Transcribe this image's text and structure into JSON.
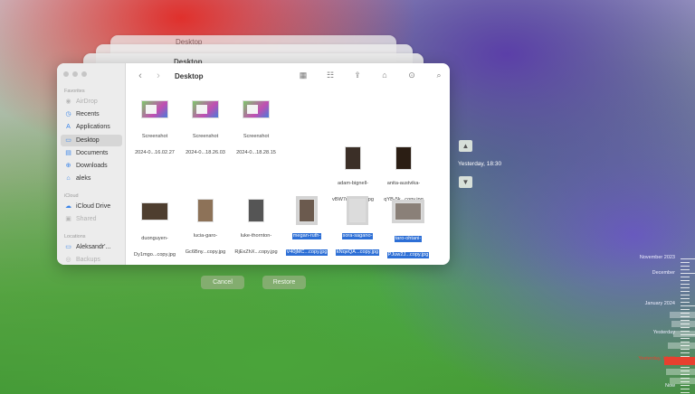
{
  "stack": {
    "back_title": "Desktop",
    "mid_title": "Desktop"
  },
  "window": {
    "title": "Desktop",
    "sidebar": {
      "favorites_header": "Favorites",
      "favorites": [
        {
          "label": "AirDrop",
          "icon": "airdrop-icon",
          "glyph": "◉",
          "dim": true
        },
        {
          "label": "Recents",
          "icon": "clock-icon",
          "glyph": "◷",
          "dim": false
        },
        {
          "label": "Applications",
          "icon": "applications-icon",
          "glyph": "A",
          "dim": false
        },
        {
          "label": "Desktop",
          "icon": "desktop-icon",
          "glyph": "▭",
          "dim": false,
          "active": true
        },
        {
          "label": "Documents",
          "icon": "document-icon",
          "glyph": "▤",
          "dim": false
        },
        {
          "label": "Downloads",
          "icon": "download-icon",
          "glyph": "⊕",
          "dim": false
        },
        {
          "label": "aleks",
          "icon": "home-icon",
          "glyph": "⌂",
          "dim": false
        }
      ],
      "icloud_header": "iCloud",
      "icloud": [
        {
          "label": "iCloud Drive",
          "icon": "cloud-icon",
          "glyph": "☁",
          "dim": false
        },
        {
          "label": "Shared",
          "icon": "shared-folder-icon",
          "glyph": "▣",
          "dim": true
        }
      ],
      "locations_header": "Locations",
      "locations": [
        {
          "label": "Aleksandr'...",
          "icon": "laptop-icon",
          "glyph": "▭",
          "dim": false
        },
        {
          "label": "Backups",
          "icon": "drive-icon",
          "glyph": "◎",
          "dim": true
        }
      ]
    },
    "files": [
      {
        "name": [
          "Screenshot",
          "2024-0...16.02.27"
        ],
        "kind": "shot"
      },
      {
        "name": [
          "Screenshot",
          "2024-0...18.26.03"
        ],
        "kind": "shot"
      },
      {
        "name": [
          "Screenshot",
          "2024-0...18.28.15"
        ],
        "kind": "shot"
      },
      {
        "name": [
          "adam-bignell-",
          "vBW7rD...copy.jpg"
        ],
        "kind": "photo-v",
        "color": "#3b2f27"
      },
      {
        "name": [
          "anita-austvika-",
          "qYB-5k...copy.jpg"
        ],
        "kind": "photo-v",
        "color": "#2b1e14"
      },
      {
        "name": [
          "duonguyen-",
          "Dy1mgo...copy.jpg"
        ],
        "kind": "photo-h",
        "color": "#4e3e2f"
      },
      {
        "name": [
          "lucia-garo-",
          "Gc6Bny...copy.jpg"
        ],
        "kind": "photo-v",
        "color": "#8d7258"
      },
      {
        "name": [
          "luke-thornton-",
          "RjExZhX...copy.jpg"
        ],
        "kind": "photo-v",
        "color": "#555555"
      },
      {
        "name": [
          "megan-ruth-",
          "V40jMC...copy.jpg"
        ],
        "kind": "photo-v",
        "color": "#6b5a4e",
        "selected": true
      },
      {
        "name": [
          "sora-sagano-",
          "kNqeQA...copy.jpg"
        ],
        "kind": "photo-v",
        "color": "#dcdcdc",
        "selected": true
      },
      {
        "name": [
          "taro-ohtani-",
          "PJuw2J...copy.jpg"
        ],
        "kind": "photo-h",
        "color": "#8a8078",
        "selected": true
      }
    ]
  },
  "buttons": {
    "cancel": "Cancel",
    "restore": "Restore"
  },
  "time_machine": {
    "current_snapshot": "Yesterday, 18:30",
    "timeline_labels": [
      "November 2023",
      "December",
      "January 2024",
      "Yesterday",
      "Yesterday, 18:30",
      "Now"
    ],
    "active_color": "#e8402f"
  }
}
